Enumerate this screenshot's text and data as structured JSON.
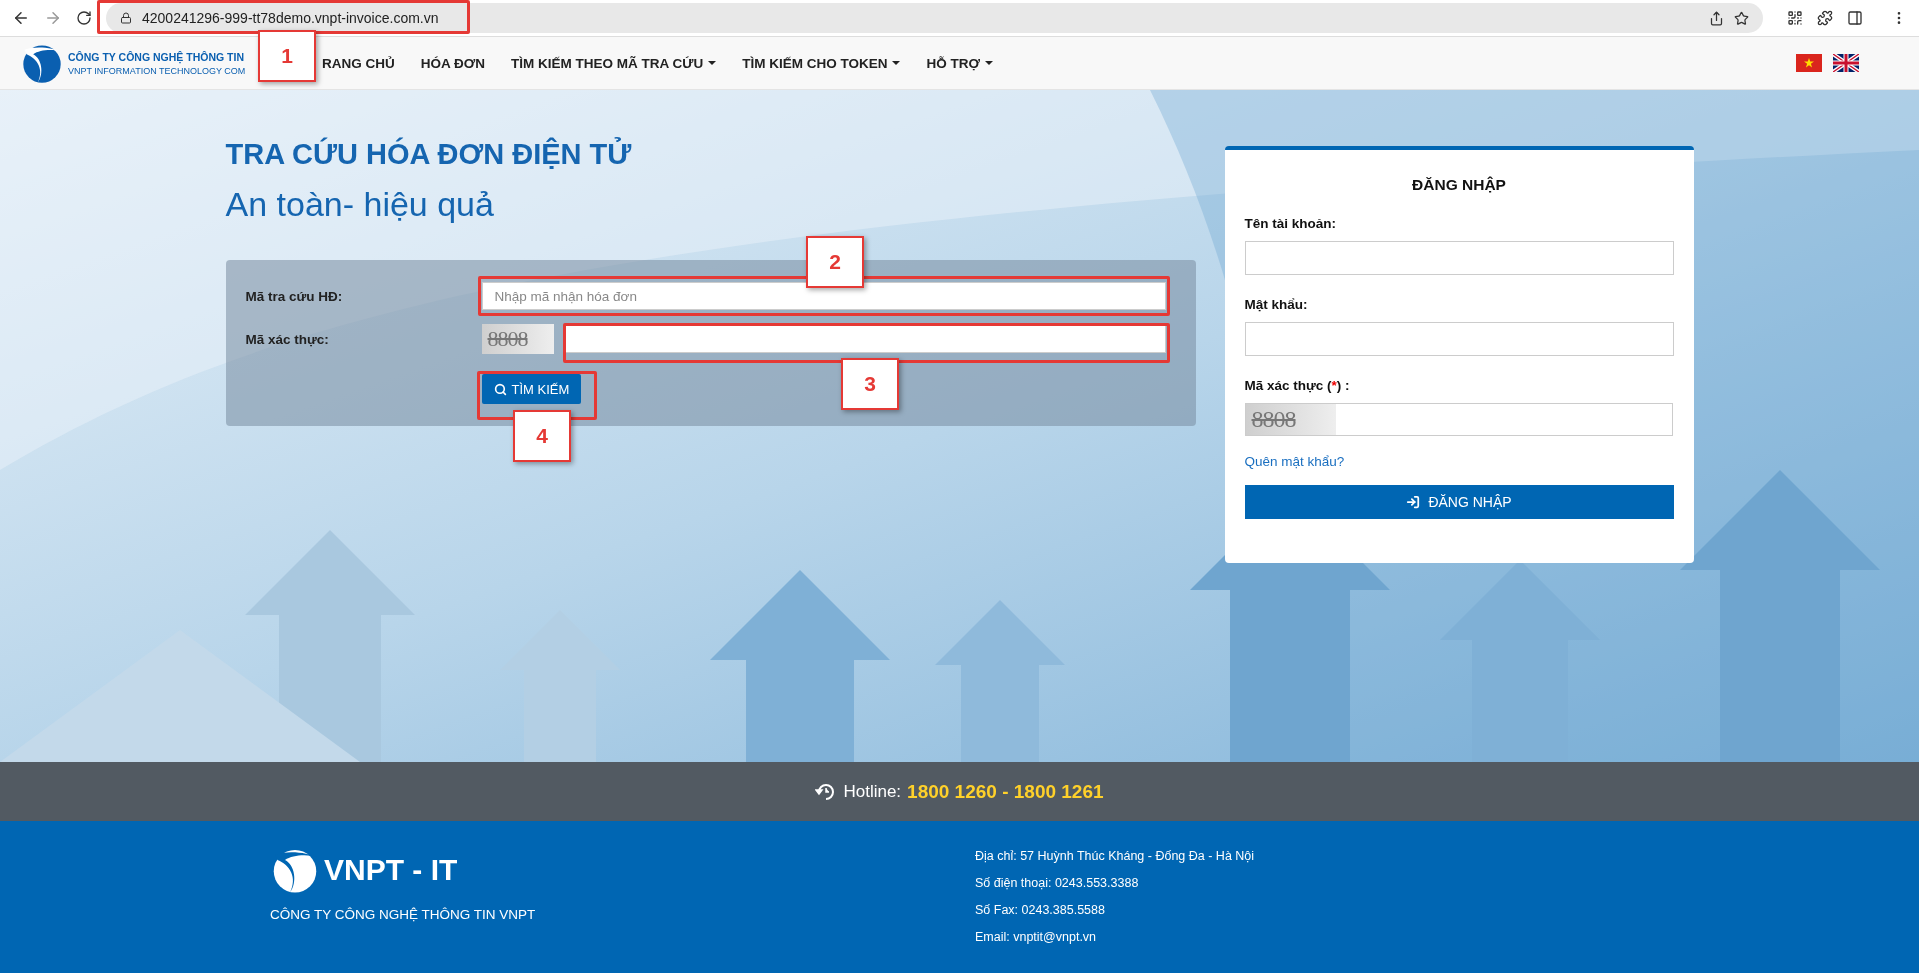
{
  "browser": {
    "url": "4200241296-999-tt78demo.vnpt-invoice.com.vn"
  },
  "header": {
    "logo_line_1": "CÔNG TY CÔNG NGHỆ THÔNG TIN",
    "logo_line_2": "VNPT INFORMATION TECHNOLOGY COM",
    "nav": [
      {
        "label": "RANG CHỦ",
        "dropdown": false
      },
      {
        "label": "HÓA ĐƠN",
        "dropdown": false
      },
      {
        "label": "TÌM KIẾM THEO MÃ TRA CỨU",
        "dropdown": true
      },
      {
        "label": "TÌM KIẾM CHO TOKEN",
        "dropdown": true
      },
      {
        "label": "HỖ TRỢ",
        "dropdown": true
      }
    ]
  },
  "search": {
    "title": "TRA CỨU HÓA ĐƠN ĐIỆN TỬ",
    "subtitle": "An toàn- hiệu quả",
    "fields": [
      {
        "label": "Mã tra cứu HĐ:",
        "kind": "text",
        "placeholder": "Nhập mã nhận hóa đơn"
      },
      {
        "label": "Mã xác thực:",
        "kind": "captcha",
        "captcha": "8808"
      }
    ],
    "button": "TÌM KIẾM"
  },
  "login": {
    "title": "ĐĂNG NHẬP",
    "fields": [
      {
        "label_before": "Tên tài khoản:",
        "kind": "text"
      },
      {
        "label_before": "Mật khẩu:",
        "kind": "password"
      },
      {
        "label_before": "Mã xác thực (",
        "required": "*",
        "label_after": ") :",
        "kind": "captcha",
        "captcha": "8808"
      }
    ],
    "forgot_link": "Quên mật khẩu?",
    "button": "ĐĂNG NHẬP"
  },
  "hotline": {
    "label": "Hotline:",
    "numbers": "1800 1260 - 1800 1261"
  },
  "footer": {
    "brand": "VNPT - IT",
    "company": "CÔNG TY CÔNG NGHỆ THÔNG TIN VNPT",
    "contacts": [
      "Địa chỉ: 57 Huỳnh Thúc Kháng - Đống Đa - Hà Nội",
      "Số điện thoại: 0243.553.3388",
      "Số Fax: 0243.385.5588",
      "Email: vnptit@vnpt.vn"
    ]
  },
  "annotations": [
    {
      "number": "1"
    },
    {
      "number": "2"
    },
    {
      "number": "3"
    },
    {
      "number": "4"
    }
  ]
}
